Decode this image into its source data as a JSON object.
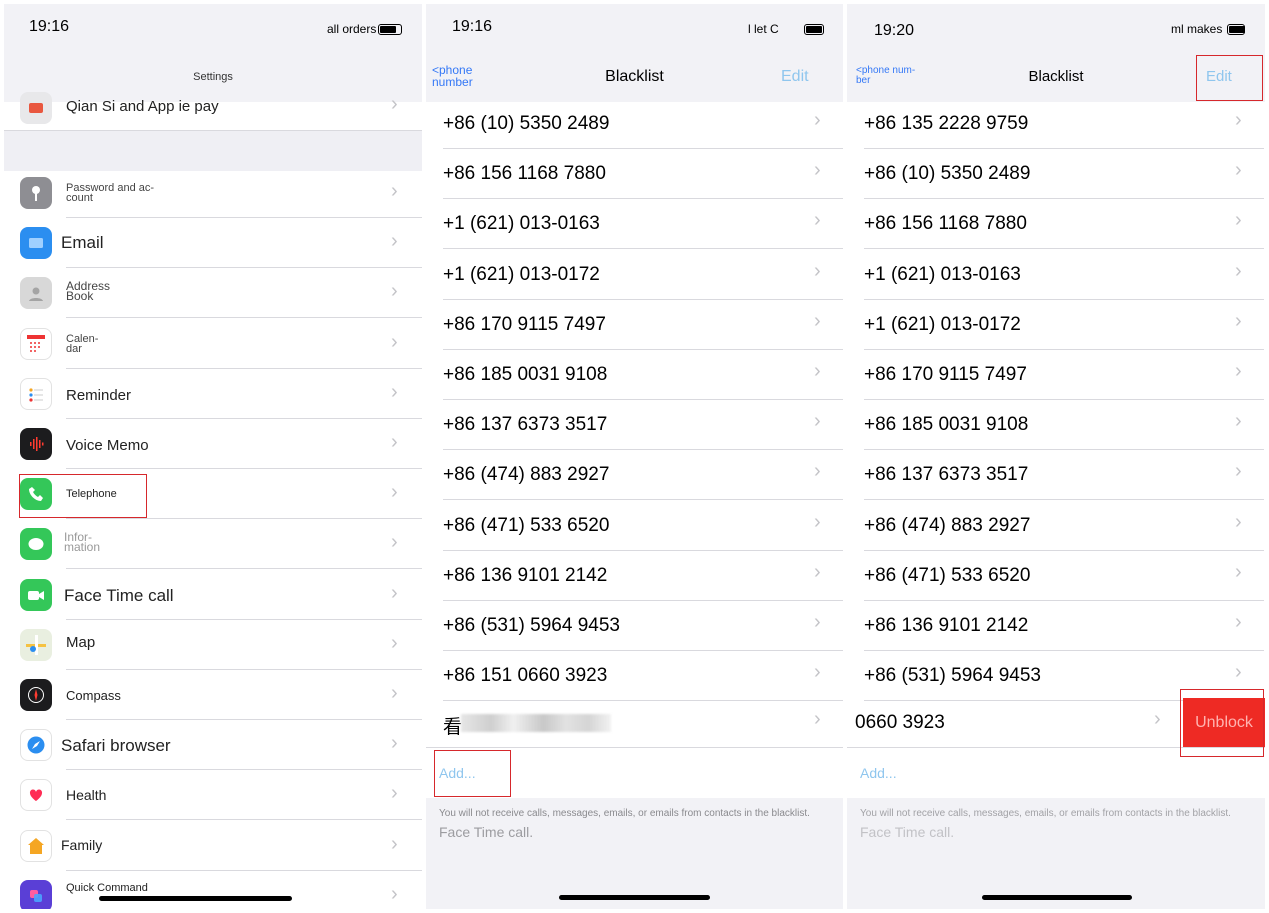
{
  "settings": {
    "time": "19:16",
    "carrier": "all orders",
    "title": "Settings",
    "top_item": "Qian Si and App ie pay",
    "items": [
      {
        "label": "Password and ac-\ncount"
      },
      {
        "label": "Email"
      },
      {
        "label": "Address\nBook"
      },
      {
        "label": "Calen-\ndar"
      },
      {
        "label": "Reminder"
      },
      {
        "label": "Voice Memo"
      },
      {
        "label": "Telephone"
      },
      {
        "label": "Infor-\nmation"
      },
      {
        "label": "Face Time call"
      },
      {
        "label": "Map"
      },
      {
        "label": "Compass"
      },
      {
        "label": "Safari browser"
      },
      {
        "label": "Health"
      },
      {
        "label": "Family"
      },
      {
        "label": "Quick Command"
      }
    ]
  },
  "blacklist1": {
    "time": "19:16",
    "carrier": "l let C",
    "back_label": "<phone\nnumber",
    "title": "Blacklist",
    "edit_label": "Edit",
    "numbers": [
      "+86 (10) 5350 2489",
      "+86 156 1168 7880",
      "+1 (621) 013-0163",
      "+1 (621) 013-0172",
      "+86 170 9115 7497",
      "+86 185 0031 9108",
      "+86 137 6373 3517",
      "+86 (474) 883 2927",
      "+86 (471) 533 6520",
      "+86 136 9101 2142",
      "+86 (531) 5964 9453",
      "+86 151 0660 3923"
    ],
    "blurred_first_char": "看",
    "add_label": "Add...",
    "footer_text": "You will not receive calls, messages, emails, or emails from contacts in the blacklist.",
    "footer_text2": "Face Time call."
  },
  "blacklist2": {
    "time": "19:20",
    "carrier": "ml makes",
    "back_label": "<phone num-\nber",
    "title": "Blacklist",
    "edit_label": "Edit",
    "numbers": [
      "+86 135 2228 9759",
      "+86 (10) 5350 2489",
      "+86 156 1168 7880",
      "+1 (621) 013-0163",
      "+1 (621) 013-0172",
      "+86 170 9115 7497",
      "+86 185 0031 9108",
      "+86 137 6373 3517",
      "+86 (474) 883 2927",
      "+86 (471) 533 6520",
      "+86 136 9101 2142",
      "+86 (531) 5964 9453"
    ],
    "swiped_number": "0660 3923",
    "unblock_label": "Unblock",
    "add_label": "Add...",
    "footer_text": "You will not receive calls, messages, emails, or emails from contacts in the blacklist.",
    "footer_text2": "Face Time call."
  },
  "colors": {
    "accent": "#3478f6",
    "highlight": "#d6282c",
    "unblock": "#ee2a24"
  }
}
